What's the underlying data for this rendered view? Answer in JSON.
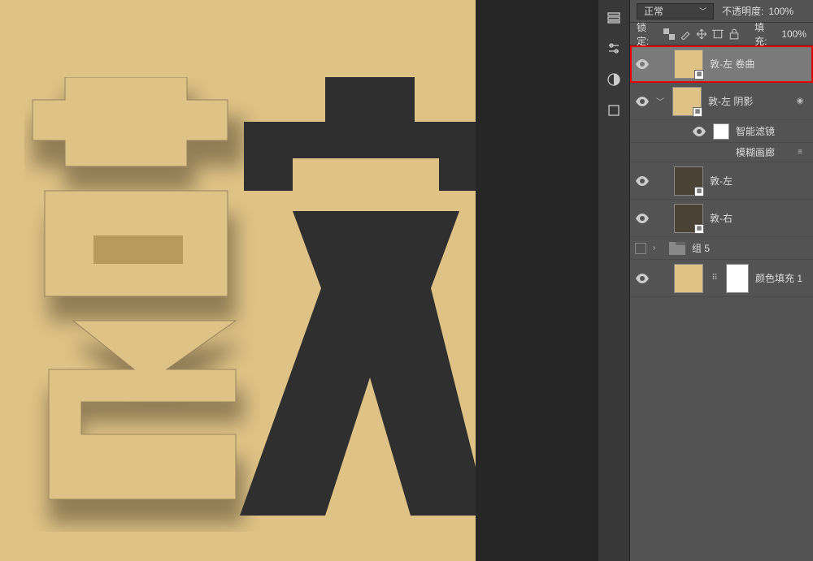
{
  "panel": {
    "blend_mode": "正常",
    "opacity_label": "不透明度:",
    "opacity_value": "100%",
    "lock_label": "锁定:",
    "fill_label": "填充:",
    "fill_value": "100%"
  },
  "layers": [
    {
      "name": "敦-左 卷曲",
      "visible": true,
      "selected": true,
      "highlighted": true,
      "smart": true,
      "thumb": "tan"
    },
    {
      "name": "敦-左 阴影",
      "visible": true,
      "selected": false,
      "smart": true,
      "thumb": "tan",
      "has_filter": true
    },
    {
      "name": "智能滤镜",
      "visible": true,
      "is_filter_header": true,
      "indent": 2
    },
    {
      "name": "模糊画廊",
      "is_filter_item": true,
      "indent": 2
    },
    {
      "name": "敦-左",
      "visible": true,
      "selected": false,
      "smart": true,
      "thumb": "tan-dark"
    },
    {
      "name": "敦-右",
      "visible": true,
      "selected": false,
      "smart": true,
      "thumb": "tan-dark"
    },
    {
      "name": "组 5",
      "is_group": true,
      "collapsed": true
    },
    {
      "name": "颜色填充 1",
      "visible": true,
      "is_fill": true,
      "linked": true
    }
  ],
  "colors": {
    "canvas_bg": "#dfc285",
    "char_dark": "#2f2f2f",
    "panel_bg": "#535353",
    "highlight": "#e20000"
  }
}
